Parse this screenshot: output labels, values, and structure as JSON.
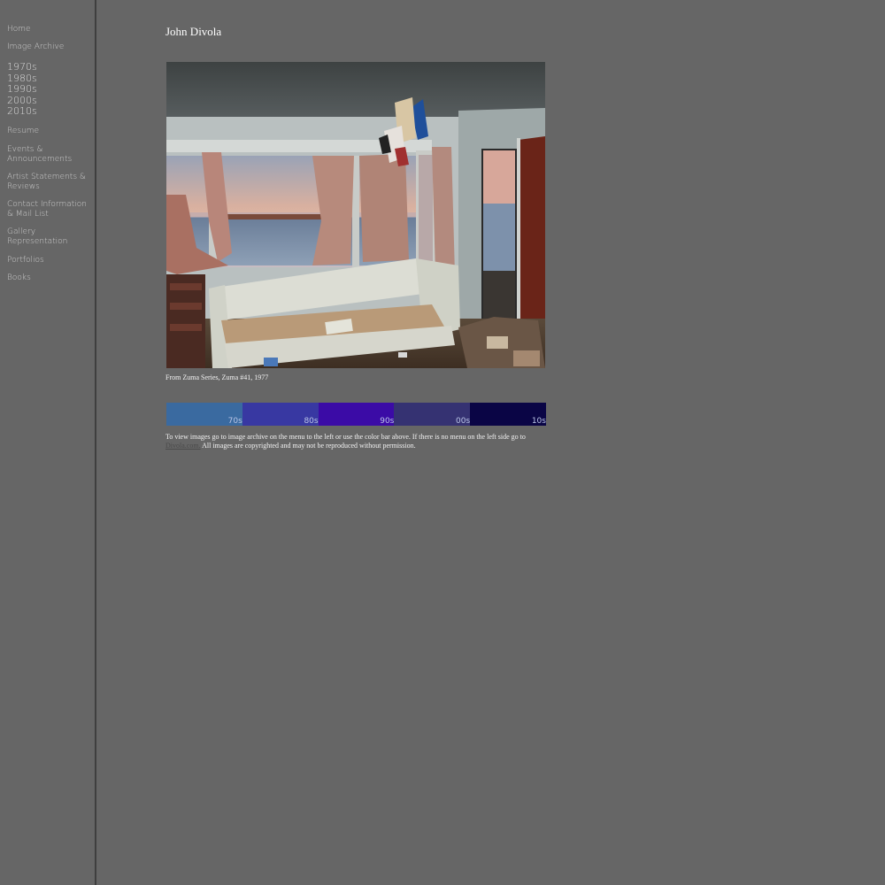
{
  "sidebar": {
    "home": "Home",
    "image_archive": "Image Archive",
    "decades": [
      "1970s",
      "1980s",
      "1990s",
      "2000s",
      "2010s"
    ],
    "resume": "Resume",
    "events": "Events & Announcements",
    "statements": "Artist Statements & Reviews",
    "contact": "Contact Information & Mail List",
    "gallery": "Gallery Representation",
    "portfolios": "Portfolios",
    "books": "Books"
  },
  "main": {
    "title": "John Divola",
    "caption": "From Zuma Series, Zuma #41, 1977",
    "color_bar": [
      {
        "label": "70s",
        "color": "#3a6aa0"
      },
      {
        "label": "80s",
        "color": "#3838a2"
      },
      {
        "label": "90s",
        "color": "#3b0ba6"
      },
      {
        "label": "00s",
        "color": "#353272"
      },
      {
        "label": "10s",
        "color": "#0a0545"
      }
    ],
    "note_prefix": "To view images go to image archive on the menu to the left or use the color bar above. If there is no menu on the left side go to",
    "note_link": "Divola.com.",
    "note_suffix": "All images are copyrighted and may not be reproduced without permission."
  }
}
